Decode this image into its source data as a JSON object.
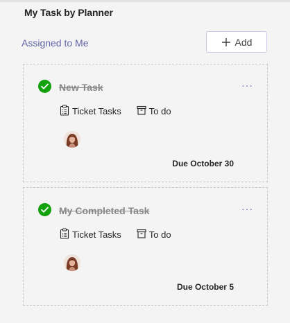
{
  "header": {
    "title": "My Task by Planner",
    "filter_label": "Assigned to Me",
    "add_label": "Add"
  },
  "tasks": [
    {
      "name": "New Task",
      "plan": "Ticket Tasks",
      "bucket": "To do",
      "due": "Due October 30",
      "status": "completed",
      "more_label": "···"
    },
    {
      "name": "My Completed Task",
      "plan": "Ticket Tasks",
      "bucket": "To do",
      "due": "Due October 5",
      "status": "completed",
      "more_label": "···"
    }
  ],
  "colors": {
    "accent": "#6264a7",
    "check_green": "#13a10e",
    "strike_text": "#8a8886"
  },
  "icons": {
    "check": "check-circle-icon",
    "plan": "clipboard-icon",
    "bucket": "archive-box-icon",
    "add": "plus-icon",
    "more": "more-horizontal-icon"
  }
}
